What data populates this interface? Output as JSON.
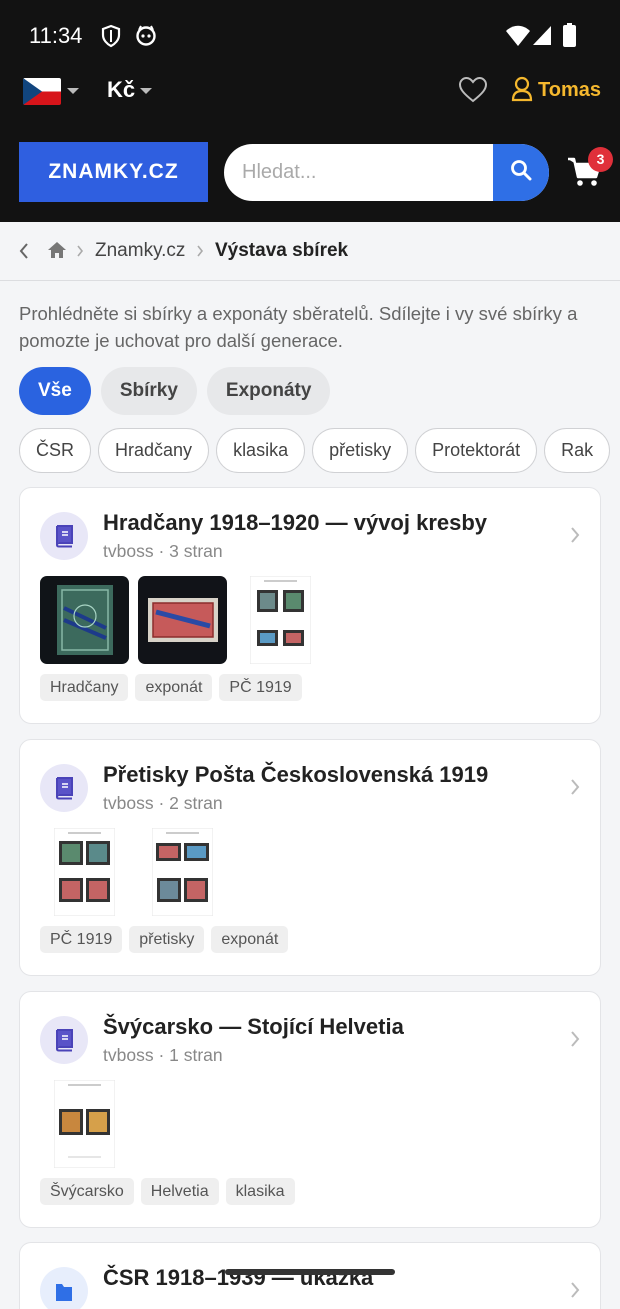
{
  "status": {
    "time": "11:34"
  },
  "header": {
    "currency": "Kč",
    "username": "Tomas",
    "logo": "ZNAMKY.CZ",
    "search_placeholder": "Hledat...",
    "cart_count": "3",
    "colors": {
      "accent": "#2f5fe0",
      "user": "#f5b82e",
      "badge": "#e0303a"
    }
  },
  "breadcrumb": {
    "link": "Znamky.cz",
    "current": "Výstava sbírek"
  },
  "intro": "Prohlédněte si sbírky a exponáty sběratelů. Sdílejte i vy své sbírky a pomozte je uchovat pro další generace.",
  "tabs": [
    {
      "label": "Vše",
      "active": true
    },
    {
      "label": "Sbírky",
      "active": false
    },
    {
      "label": "Exponáty",
      "active": false
    }
  ],
  "chips": [
    "ČSR",
    "Hradčany",
    "klasika",
    "přetisky",
    "Protektorát",
    "Rak"
  ],
  "cards": [
    {
      "title": "Hradčany 1918–1920 — vývoj kresby",
      "subtitle": "tvboss · 3 stran",
      "icon": "book-icon",
      "tags": [
        "Hradčany",
        "exponát",
        "PČ 1919"
      ]
    },
    {
      "title": "Přetisky Pošta Československá 1919",
      "subtitle": "tvboss · 2 stran",
      "icon": "book-icon",
      "tags": [
        "PČ 1919",
        "přetisky",
        "exponát"
      ]
    },
    {
      "title": "Švýcarsko — Stojící Helvetia",
      "subtitle": "tvboss · 1 stran",
      "icon": "book-icon",
      "tags": [
        "Švýcarsko",
        "Helvetia",
        "klasika"
      ]
    },
    {
      "title": "ČSR 1918–1939 — ukázka",
      "icon": "folder-icon"
    }
  ]
}
